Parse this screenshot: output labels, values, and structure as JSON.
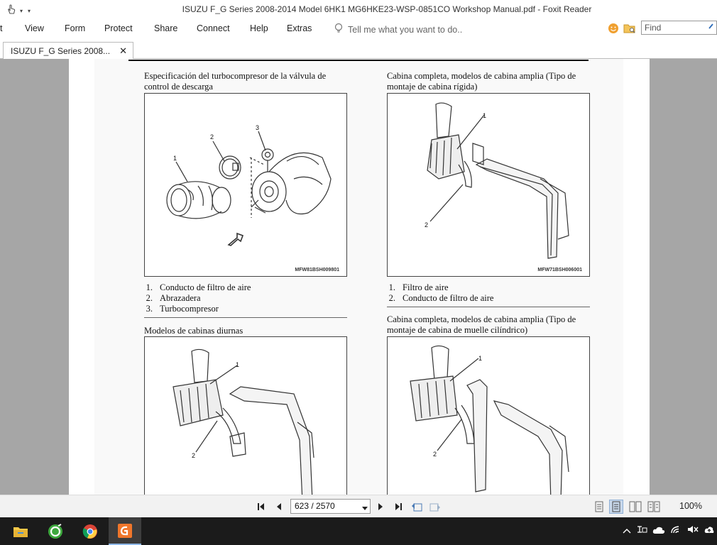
{
  "window": {
    "title": "ISUZU F_G Series 2008-2014 Model 6HK1 MG6HKE23-WSP-0851CO Workshop Manual.pdf - Foxit Reader"
  },
  "menu": {
    "items": [
      "t",
      "View",
      "Form",
      "Protect",
      "Share",
      "Connect",
      "Help",
      "Extras"
    ],
    "tell_me": "Tell me what you want to do..",
    "find_placeholder": "Find"
  },
  "tab": {
    "label": "ISUZU F_G Series 2008...",
    "close": "✕"
  },
  "document": {
    "sec1": {
      "title_line1": "Especificación del turbocompresor de la válvula de",
      "title_line2": "control de descarga",
      "fig_code": "MFW81BSH009801",
      "callouts": [
        "1",
        "2",
        "3"
      ],
      "legend": [
        {
          "num": "1.",
          "text": "Conducto de filtro de aire"
        },
        {
          "num": "2.",
          "text": "Abrazadera"
        },
        {
          "num": "3.",
          "text": "Turbocompresor"
        }
      ]
    },
    "sec2": {
      "title_line1": "Cabina completa, modelos de cabina amplia (Tipo de",
      "title_line2": "montaje de cabina rígida)",
      "fig_code": "MFW71BSH006001",
      "callouts": [
        "1",
        "2"
      ],
      "legend": [
        {
          "num": "1.",
          "text": "Filtro de aire"
        },
        {
          "num": "2.",
          "text": "Conducto de filtro de aire"
        }
      ]
    },
    "sec3": {
      "title_line1": "Modelos de cabinas diurnas",
      "callouts": [
        "1",
        "2"
      ]
    },
    "sec4": {
      "title_line1": "Cabina completa, modelos de cabina amplia (Tipo de",
      "title_line2": "montaje de cabina de muelle cilíndrico)",
      "callouts": [
        "1",
        "2"
      ]
    }
  },
  "navigation": {
    "page_display": "623 / 2570",
    "current_page": 623,
    "total_pages": 2570,
    "zoom": "100%"
  },
  "taskbar": {
    "apps": [
      "file-explorer-icon",
      "cleaner-app-icon",
      "chrome-icon",
      "foxit-reader-icon"
    ],
    "active_app": "foxit-reader-icon"
  }
}
